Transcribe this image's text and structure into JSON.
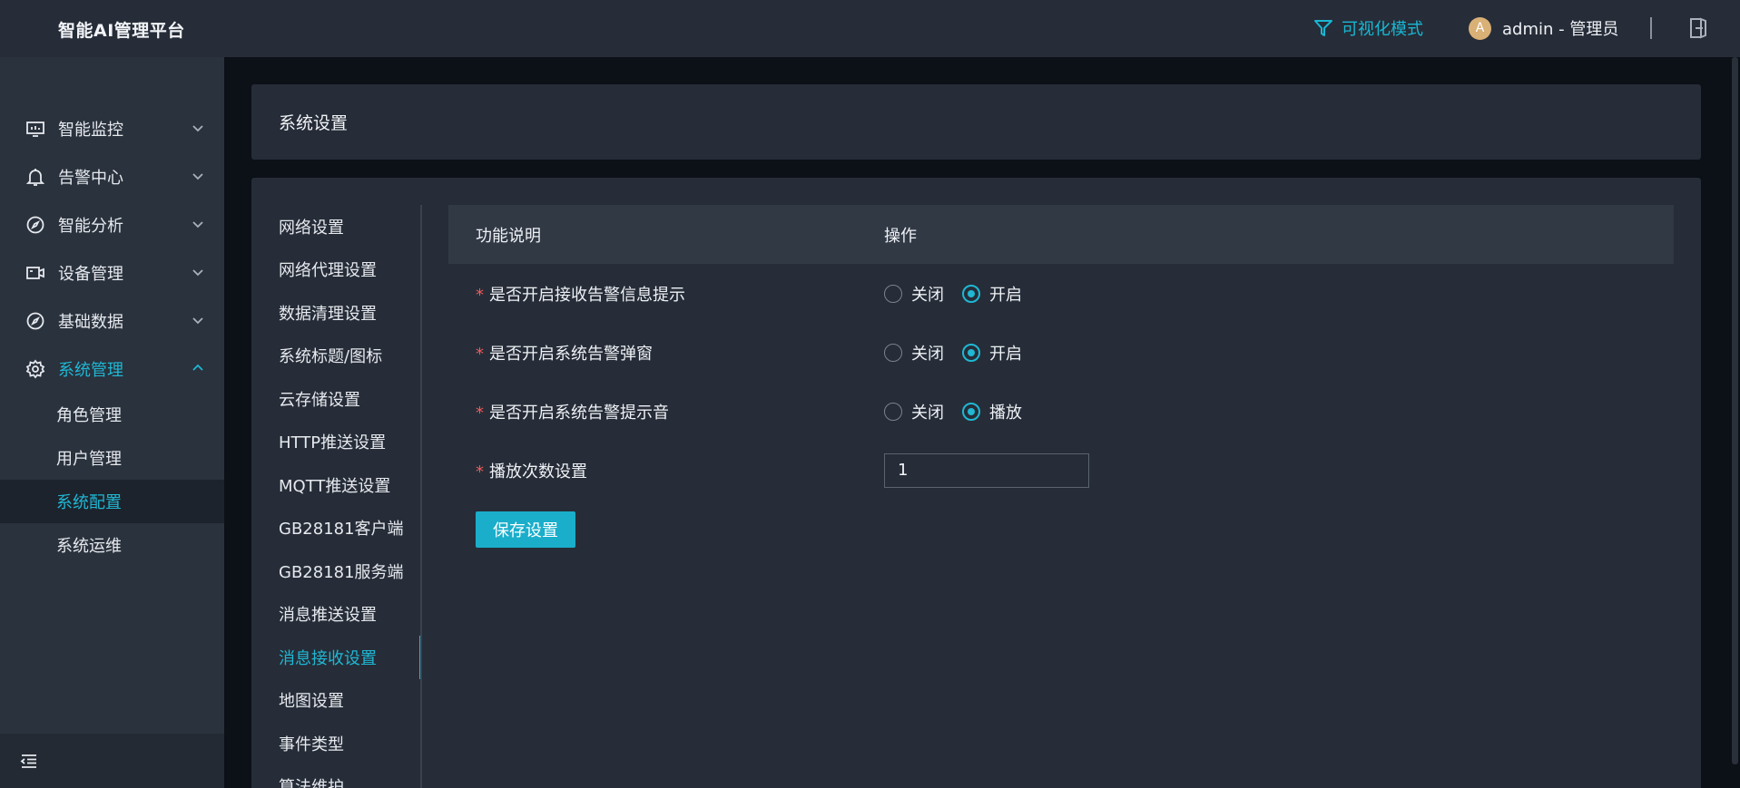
{
  "app": {
    "title": "智能AI管理平台"
  },
  "topbar": {
    "viz_mode_label": "可视化模式",
    "avatar_letter": "A",
    "user_label": "admin - 管理员"
  },
  "sidebar": {
    "menu": [
      {
        "label": "智能监控",
        "icon": "monitor-icon"
      },
      {
        "label": "告警中心",
        "icon": "bell-icon"
      },
      {
        "label": "智能分析",
        "icon": "compass-icon"
      },
      {
        "label": "设备管理",
        "icon": "camera-icon"
      },
      {
        "label": "基础数据",
        "icon": "compass-icon"
      },
      {
        "label": "系统管理",
        "icon": "gear-icon",
        "expanded": true
      }
    ],
    "submenu": [
      {
        "label": "角色管理"
      },
      {
        "label": "用户管理"
      },
      {
        "label": "系统配置",
        "active": true
      },
      {
        "label": "系统运维"
      }
    ]
  },
  "page": {
    "title": "系统设置"
  },
  "settings_nav": [
    "网络设置",
    "网络代理设置",
    "数据清理设置",
    "系统标题/图标",
    "云存储设置",
    "HTTP推送设置",
    "MQTT推送设置",
    "GB28181客户端",
    "GB28181服务端",
    "消息推送设置",
    "消息接收设置",
    "地图设置",
    "事件类型",
    "算法维护"
  ],
  "settings_nav_active": "消息接收设置",
  "table": {
    "headers": {
      "desc": "功能说明",
      "op": "操作"
    },
    "rows": [
      {
        "label": "是否开启接收告警信息提示",
        "off": "关闭",
        "on": "开启",
        "value": "on"
      },
      {
        "label": "是否开启系统告警弹窗",
        "off": "关闭",
        "on": "开启",
        "value": "on"
      },
      {
        "label": "是否开启系统告警提示音",
        "off": "关闭",
        "on": "播放",
        "value": "on"
      }
    ],
    "play_count": {
      "label": "播放次数设置",
      "value": "1"
    },
    "required_mark": "*"
  },
  "buttons": {
    "save": "保存设置"
  },
  "colors": {
    "accent": "#1fb7d4",
    "required": "#f35a5a",
    "sidebar_bg": "#2a323d",
    "card_bg": "#262d38"
  }
}
